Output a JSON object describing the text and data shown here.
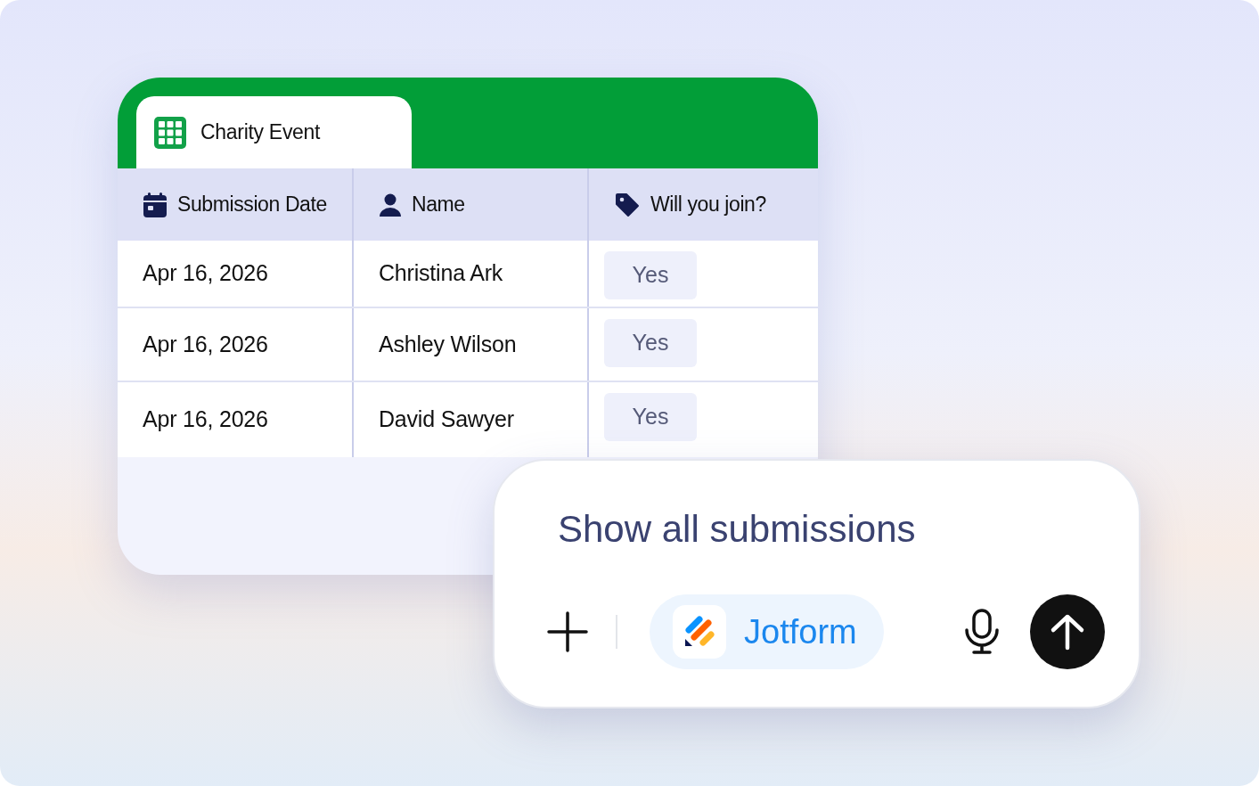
{
  "sheet": {
    "tab": {
      "title": "Charity Event"
    },
    "columns": [
      {
        "label": "Submission Date",
        "kind": "date"
      },
      {
        "label": "Name",
        "kind": "person"
      },
      {
        "label": "Will you join?",
        "kind": "tag"
      }
    ],
    "rows": [
      {
        "date": "Apr 16, 2026",
        "name": "Christina Ark",
        "answer": "Yes"
      },
      {
        "date": "Apr 16, 2026",
        "name": "Ashley Wilson",
        "answer": "Yes"
      },
      {
        "date": "Apr 16, 2026",
        "name": "David Sawyer",
        "answer": "Yes"
      }
    ]
  },
  "prompt": {
    "text": "Show all submissions",
    "app_chip": "Jotform"
  }
}
